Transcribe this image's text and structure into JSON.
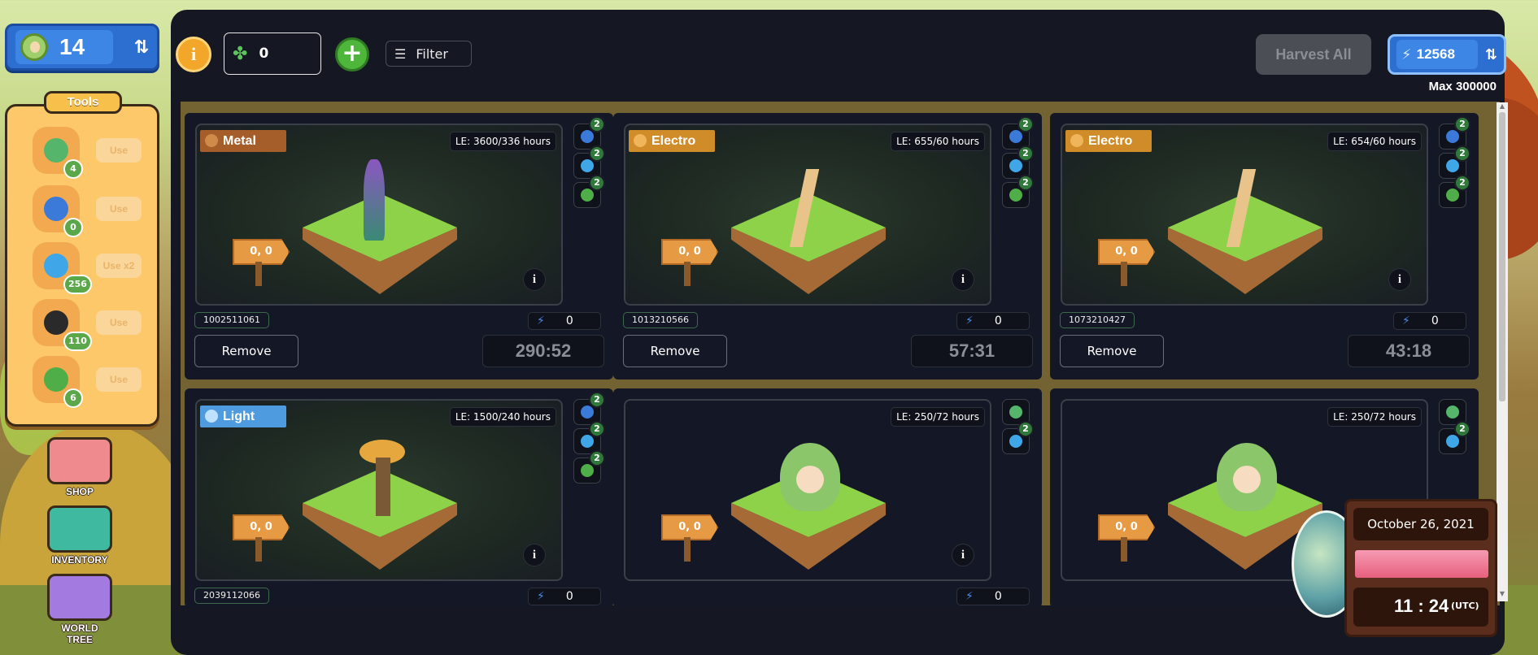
{
  "top_stat": {
    "value": "14"
  },
  "tools": {
    "title": "Tools",
    "items": [
      {
        "count": "4",
        "action": "Use",
        "color": "#55b56a"
      },
      {
        "count": "0",
        "action": "Use",
        "color": "#3b7ad8"
      },
      {
        "count": "256",
        "action": "Use x2",
        "color": "#3fa7e8"
      },
      {
        "count": "110",
        "action": "Use",
        "color": "#2a2a2a"
      },
      {
        "count": "6",
        "action": "Use",
        "color": "#4fae48"
      }
    ]
  },
  "nav": {
    "shop": "SHOP",
    "inventory": "INVENTORY",
    "world_tree": "WORLD TREE"
  },
  "toolbar": {
    "info": "i",
    "clover_value": "0",
    "plus": "+",
    "filter_label": "Filter",
    "harvest_all": "Harvest All",
    "energy_value": "12568",
    "max_label": "Max 300000"
  },
  "cards": [
    {
      "element": "Metal",
      "element_color": "#a55d2a",
      "le": "LE: 3600/336 hours",
      "sign": "0, 0",
      "id": "1002511061",
      "energy": "0",
      "remove": "Remove",
      "timer": "290:52",
      "slots": [
        "2",
        "2",
        "2"
      ],
      "info": "i"
    },
    {
      "element": "Electro",
      "element_color": "#d18c2a",
      "le": "LE: 655/60 hours",
      "sign": "0, 0",
      "id": "1013210566",
      "energy": "0",
      "remove": "Remove",
      "timer": "57:31",
      "slots": [
        "2",
        "2",
        "2"
      ],
      "info": "i"
    },
    {
      "element": "Electro",
      "element_color": "#d18c2a",
      "le": "LE: 654/60 hours",
      "sign": "0, 0",
      "id": "1073210427",
      "energy": "0",
      "remove": "Remove",
      "timer": "43:18",
      "slots": [
        "2",
        "2",
        "2"
      ],
      "info": "i"
    },
    {
      "element": "Light",
      "element_color": "#4f9be0",
      "le": "LE: 1500/240 hours",
      "sign": "0, 0",
      "id": "2039112066",
      "energy": "0",
      "slots": [
        "2",
        "2",
        "2"
      ],
      "info": "i"
    },
    {
      "le": "LE: 250/72 hours",
      "sign": "0, 0",
      "energy": "0",
      "slots": [
        "",
        "2"
      ],
      "info": "i"
    },
    {
      "le": "LE: 250/72 hours",
      "sign": "0, 0",
      "slots": [
        "",
        "2"
      ]
    }
  ],
  "date_widget": {
    "date": "October 26, 2021",
    "time": "11 : 24",
    "tz": "(UTC)"
  }
}
